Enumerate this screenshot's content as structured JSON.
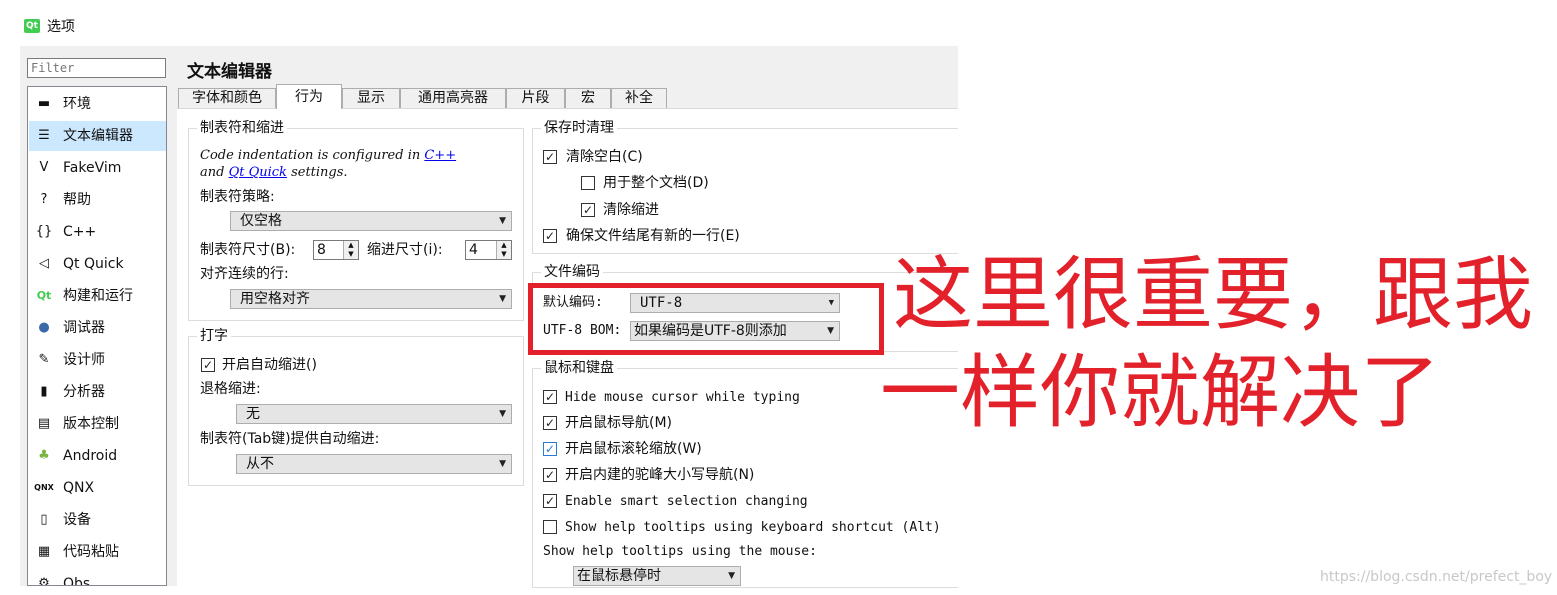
{
  "window": {
    "title": "选项",
    "app_icon": "Qt"
  },
  "filter": {
    "placeholder": "Filter"
  },
  "sidebar": {
    "items": [
      {
        "label": "环境",
        "icon": "environment-icon",
        "glyph": "▬"
      },
      {
        "label": "文本编辑器",
        "icon": "text-editor-icon",
        "glyph": "☰",
        "selected": true
      },
      {
        "label": "FakeVim",
        "icon": "fakevim-icon",
        "glyph": "V"
      },
      {
        "label": "帮助",
        "icon": "help-icon",
        "glyph": "?"
      },
      {
        "label": "C++",
        "icon": "cpp-braces-icon",
        "glyph": "{}"
      },
      {
        "label": "Qt Quick",
        "icon": "qt-quick-icon",
        "glyph": "◁"
      },
      {
        "label": "构建和运行",
        "icon": "build-run-icon",
        "glyph": "Qt"
      },
      {
        "label": "调试器",
        "icon": "debugger-icon",
        "glyph": "●"
      },
      {
        "label": "设计师",
        "icon": "designer-icon",
        "glyph": "✎"
      },
      {
        "label": "分析器",
        "icon": "analyzer-icon",
        "glyph": "▮"
      },
      {
        "label": "版本控制",
        "icon": "version-control-icon",
        "glyph": "▤"
      },
      {
        "label": "Android",
        "icon": "android-icon",
        "glyph": "♣"
      },
      {
        "label": "QNX",
        "icon": "qnx-icon",
        "glyph": "QNX"
      },
      {
        "label": "设备",
        "icon": "device-icon",
        "glyph": "▯"
      },
      {
        "label": "代码粘贴",
        "icon": "code-paste-icon",
        "glyph": "▦"
      },
      {
        "label": "Qbs",
        "icon": "qbs-icon",
        "glyph": "⚙"
      }
    ]
  },
  "page": {
    "title": "文本编辑器"
  },
  "tabs": [
    "字体和颜色",
    "行为",
    "显示",
    "通用高亮器",
    "片段",
    "宏",
    "补全"
  ],
  "tabs_and_indent": {
    "title": "制表符和缩进",
    "info_line1_prefix": "Code indentation is configured in ",
    "info_link_cpp": "C++",
    "info_line2_prefix": "and ",
    "info_link_qtquick": "Qt Quick",
    "info_line2_suffix": " settings.",
    "policy_label": "制表符策略:",
    "policy_value": "仅空格",
    "tab_size_label": "制表符尺寸(B):",
    "tab_size_value": "8",
    "indent_size_label": "缩进尺寸(i):",
    "indent_size_value": "4",
    "align_label": "对齐连续的行:",
    "align_value": "用空格对齐"
  },
  "typing": {
    "title": "打字",
    "auto_indent_label": "开启自动缩进()",
    "auto_indent_checked": true,
    "backspace_label": "退格缩进:",
    "backspace_value": "无",
    "tab_key_label": "制表符(Tab键)提供自动缩进:",
    "tab_key_value": "从不"
  },
  "cleanup": {
    "title": "保存时清理",
    "items": [
      {
        "label": "清除空白(C)",
        "checked": true
      },
      {
        "label": "用于整个文档(D)",
        "checked": false
      },
      {
        "label": "清除缩进",
        "checked": true
      },
      {
        "label": "确保文件结尾有新的一行(E)",
        "checked": true
      }
    ]
  },
  "encoding": {
    "title": "文件编码",
    "default_label": "默认编码:",
    "default_value": "UTF-8",
    "bom_label": "UTF-8 BOM:",
    "bom_value": "如果编码是UTF-8则添加"
  },
  "mouse": {
    "title": "鼠标和键盘",
    "items": [
      {
        "label": "Hide mouse cursor while typing",
        "checked": true
      },
      {
        "label": "开启鼠标导航(M)",
        "checked": true
      },
      {
        "label": "开启鼠标滚轮缩放(W)",
        "checked": true
      },
      {
        "label": "开启内建的驼峰大小写导航(N)",
        "checked": true
      },
      {
        "label": "Enable smart selection changing",
        "checked": true
      },
      {
        "label": "Show help tooltips using keyboard shortcut (Alt)",
        "checked": false
      }
    ],
    "tooltip_label": "Show help tooltips using the mouse:",
    "tooltip_value": "在鼠标悬停时"
  },
  "annotation": {
    "line1": "这里很重要，跟我",
    "line2": "一样你就解决了",
    "color": "#e3212b"
  },
  "watermark": "https://blog.csdn.net/prefect_boy",
  "colors": {
    "selection": "#cce8ff",
    "link": "#0000ee",
    "annotation": "#e3212b"
  }
}
